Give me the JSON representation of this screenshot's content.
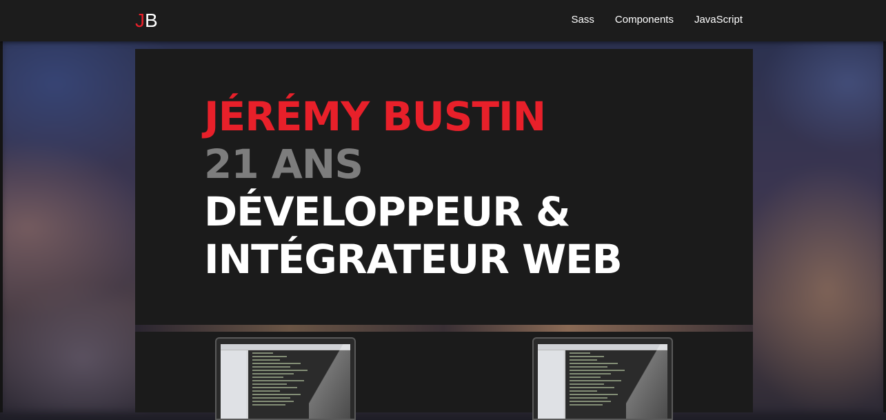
{
  "logo": {
    "first": "J",
    "second": "B"
  },
  "nav": {
    "items": [
      "Sass",
      "Components",
      "JavaScript"
    ]
  },
  "hero": {
    "name": "Jérémy Bustin",
    "age": "21 ans",
    "role_line1": "Développeur &",
    "role_line2": "Intégrateur web"
  },
  "colors": {
    "accent": "#e8202a",
    "muted": "#7d7d7d",
    "panel": "#1b1b1b",
    "navbar": "#1c1c1c"
  },
  "projects": {
    "count_visible": 2
  }
}
